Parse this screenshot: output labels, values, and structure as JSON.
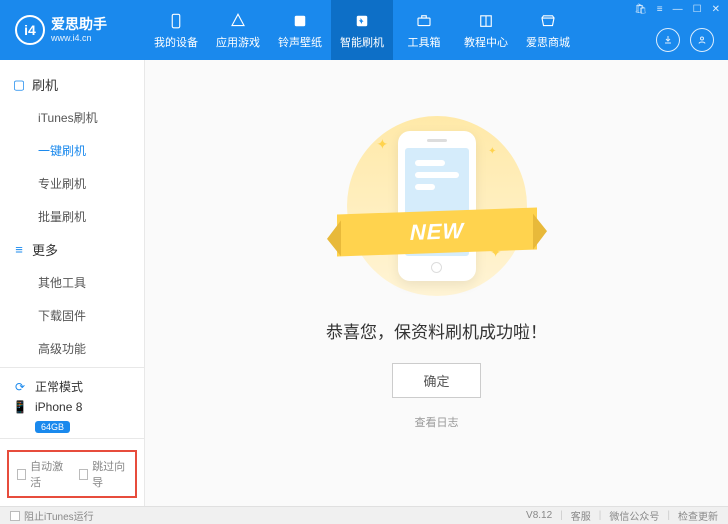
{
  "app": {
    "logo_letters": "i4",
    "name": "爱思助手",
    "url": "www.i4.cn"
  },
  "nav": {
    "tabs": [
      {
        "label": "我的设备"
      },
      {
        "label": "应用游戏"
      },
      {
        "label": "铃声壁纸"
      },
      {
        "label": "智能刷机"
      },
      {
        "label": "工具箱"
      },
      {
        "label": "教程中心"
      },
      {
        "label": "爱思商城"
      }
    ]
  },
  "sidebar": {
    "cats": [
      {
        "label": "刷机",
        "items": [
          {
            "label": "iTunes刷机"
          },
          {
            "label": "一键刷机"
          },
          {
            "label": "专业刷机"
          },
          {
            "label": "批量刷机"
          }
        ]
      },
      {
        "label": "更多",
        "items": [
          {
            "label": "其他工具"
          },
          {
            "label": "下载固件"
          },
          {
            "label": "高级功能"
          }
        ]
      }
    ],
    "mode": "正常模式",
    "device": "iPhone 8",
    "storage": "64GB",
    "auto_activate": "自动激活",
    "skip_wizard": "跳过向导"
  },
  "main": {
    "ribbon": "NEW",
    "success": "恭喜您，保资料刷机成功啦！",
    "ok": "确定",
    "view_log": "查看日志"
  },
  "footer": {
    "block_itunes": "阻止iTunes运行",
    "version": "V8.12",
    "support": "客服",
    "wechat": "微信公众号",
    "update": "检查更新"
  }
}
